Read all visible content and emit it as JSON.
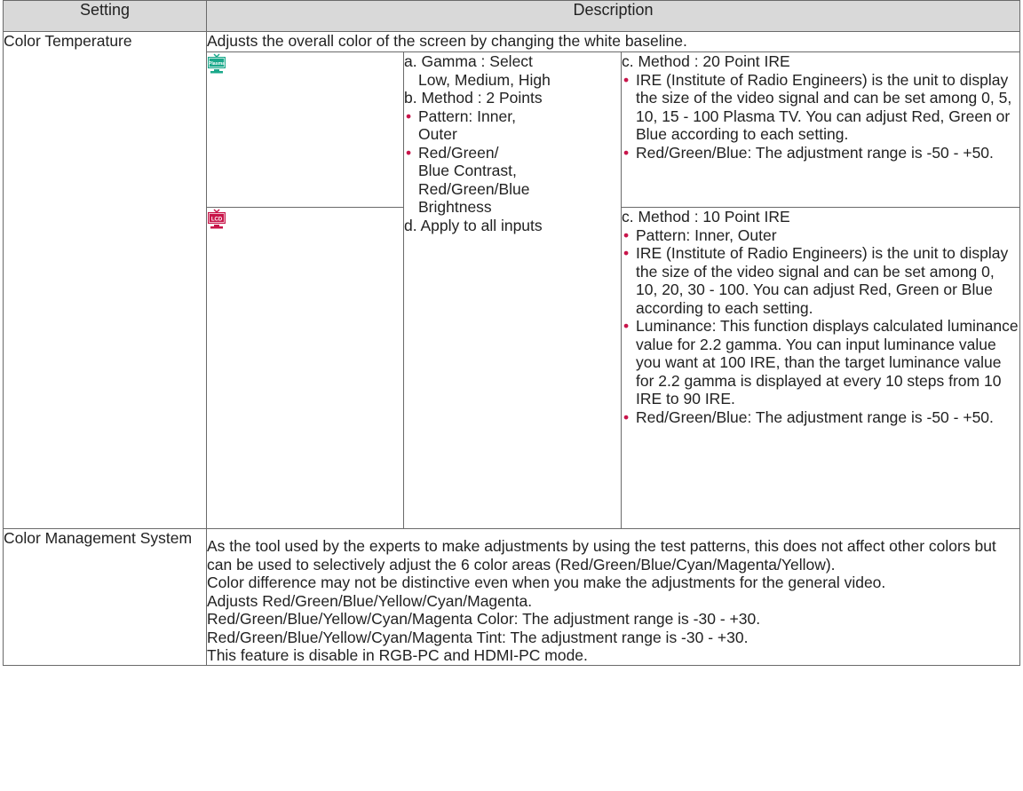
{
  "header": {
    "setting": "Setting",
    "description": "Description"
  },
  "color_temperature": {
    "name": "Color Temperature",
    "summary": "Adjusts the overall color of the screen by changing the white baseline.",
    "plasma_icon_label": "Plasma",
    "lcd_icon_label": "LCD",
    "common": {
      "a_line1": "a. Gamma : Select",
      "a_line2": "Low, Medium, High",
      "b": "b. Method : 2 Points",
      "bullet1_line1": "Pattern: Inner,",
      "bullet1_line2": "Outer",
      "bullet2_line1": "Red/Green/",
      "bullet2_line2": "Blue Contrast,",
      "bullet2_line3": "Red/Green/Blue",
      "bullet2_line4": "Brightness",
      "d": "d. Apply to all inputs"
    },
    "plasma": {
      "c": "c. Method : 20 Point IRE",
      "bullets": [
        "IRE (Institute of Radio Engineers) is the unit to display the size of the video signal and can be set among 0, 5, 10, 15 - 100 Plasma TV. You can adjust Red, Green or Blue according to each setting.",
        "Red/Green/Blue: The adjustment range is -50 - +50."
      ]
    },
    "lcd": {
      "c": "c. Method : 10 Point IRE",
      "bullets": [
        "Pattern: Inner, Outer",
        "IRE (Institute of Radio Engineers) is the unit to display the size of the video signal and can be set among 0, 10, 20, 30 - 100. You can adjust Red, Green or Blue according to each setting.",
        "Luminance: This function displays calculated luminance value for 2.2 gamma. You can input luminance value you want at 100 IRE, than the target luminance value for 2.2 gamma is displayed at every 10 steps from 10 IRE to 90 IRE.",
        "Red/Green/Blue: The adjustment range is -50 - +50."
      ]
    }
  },
  "color_management": {
    "name": "Color Management System",
    "paragraphs": [
      "As the tool used by the experts to make adjustments by using the test patterns, this does not affect other colors but can be used to selectively adjust the 6 color areas (Red/Green/Blue/Cyan/Magenta/Yellow).",
      "Color difference may not be distinctive even when you make the adjustments for the general video.",
      "Adjusts Red/Green/Blue/Yellow/Cyan/Magenta.",
      "Red/Green/Blue/Yellow/Cyan/Magenta Color: The adjustment range is -30 - +30.",
      "Red/Green/Blue/Yellow/Cyan/Magenta Tint: The adjustment range is -30 - +30.",
      "This feature is disable in RGB-PC and HDMI-PC mode."
    ]
  },
  "colors": {
    "header_bg": "#d9d9d9",
    "border": "#6a6a6a",
    "bullet": "#c8154a",
    "plasma_icon": "#1aa88a",
    "lcd_icon": "#c8154a"
  },
  "icons": {
    "plasma": "plasma-tv-icon",
    "lcd": "lcd-tv-icon"
  }
}
